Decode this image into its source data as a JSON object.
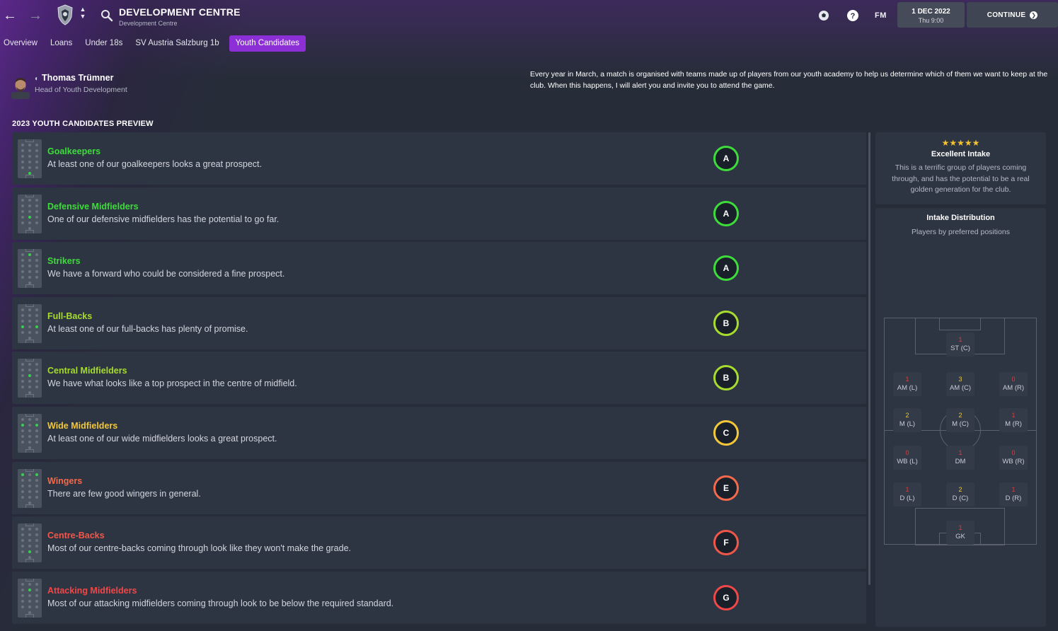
{
  "header": {
    "title": "DEVELOPMENT CENTRE",
    "subtitle": "Development Centre",
    "fm_logo": "FM",
    "date": "1 DEC 2022",
    "time": "Thu 9:00",
    "continue_label": "CONTINUE"
  },
  "tabs": [
    {
      "label": "Overview",
      "active": false
    },
    {
      "label": "Loans",
      "active": false
    },
    {
      "label": "Under 18s",
      "active": false
    },
    {
      "label": "SV Austria Salzburg 1b",
      "active": false
    },
    {
      "label": "Youth Candidates",
      "active": true
    }
  ],
  "staff": {
    "name": "Thomas Trümner",
    "role": "Head of Youth Development"
  },
  "info_text": "Every year in March, a match is organised with teams made up of players from our youth academy to help us determine which of them we want to keep at the club. When this happens, I will alert you and invite you to attend the game.",
  "section_title": "2023 YOUTH CANDIDATES PREVIEW",
  "candidates": [
    {
      "title": "Goalkeepers",
      "description": "At least one of our goalkeepers looks a great prospect.",
      "grade": "A",
      "color": "#3ddc3b"
    },
    {
      "title": "Defensive Midfielders",
      "description": "One of our defensive midfielders has the potential to go far.",
      "grade": "A",
      "color": "#3ddc3b"
    },
    {
      "title": "Strikers",
      "description": "We have a forward who could be considered a fine prospect.",
      "grade": "A",
      "color": "#3ddc3b"
    },
    {
      "title": "Full-Backs",
      "description": "At least one of our full-backs has plenty of promise.",
      "grade": "B",
      "color": "#a6dc2e"
    },
    {
      "title": "Central Midfielders",
      "description": "We have what looks like a top prospect in the centre of midfield.",
      "grade": "B",
      "color": "#a6dc2e"
    },
    {
      "title": "Wide Midfielders",
      "description": "At least one of our wide midfielders looks a great prospect.",
      "grade": "C",
      "color": "#f2c83a"
    },
    {
      "title": "Wingers",
      "description": "There are few good wingers in general.",
      "grade": "E",
      "color": "#f26a4b"
    },
    {
      "title": "Centre-Backs",
      "description": "Most of our centre-backs coming through look like they won't make the grade.",
      "grade": "F",
      "color": "#f0574a"
    },
    {
      "title": "Attacking Midfielders",
      "description": "Most of our attacking midfielders coming through look to be below the required standard.",
      "grade": "G",
      "color": "#f04848"
    }
  ],
  "intake": {
    "stars": 5,
    "title": "Excellent Intake",
    "text": "This is a terrific group of players coming through, and has the potential to be a real golden generation for the club."
  },
  "distribution": {
    "title": "Intake Distribution",
    "subtitle": "Players by preferred positions",
    "positions": [
      {
        "label": "ST (C)",
        "count": "1",
        "color": "#e23b3b"
      },
      {
        "label": "AM (L)",
        "count": "1",
        "color": "#e23b3b"
      },
      {
        "label": "AM (C)",
        "count": "3",
        "color": "#f2c83a"
      },
      {
        "label": "AM (R)",
        "count": "0",
        "color": "#e23b3b"
      },
      {
        "label": "M (L)",
        "count": "2",
        "color": "#f2c83a"
      },
      {
        "label": "M (C)",
        "count": "2",
        "color": "#f2c83a"
      },
      {
        "label": "M (R)",
        "count": "1",
        "color": "#e23b3b"
      },
      {
        "label": "WB (L)",
        "count": "0",
        "color": "#e23b3b"
      },
      {
        "label": "DM",
        "count": "1",
        "color": "#e23b3b"
      },
      {
        "label": "WB (R)",
        "count": "0",
        "color": "#e23b3b"
      },
      {
        "label": "D (L)",
        "count": "1",
        "color": "#e23b3b"
      },
      {
        "label": "D (C)",
        "count": "2",
        "color": "#f2c83a"
      },
      {
        "label": "D (R)",
        "count": "1",
        "color": "#e23b3b"
      },
      {
        "label": "GK",
        "count": "1",
        "color": "#e23b3b"
      }
    ]
  }
}
